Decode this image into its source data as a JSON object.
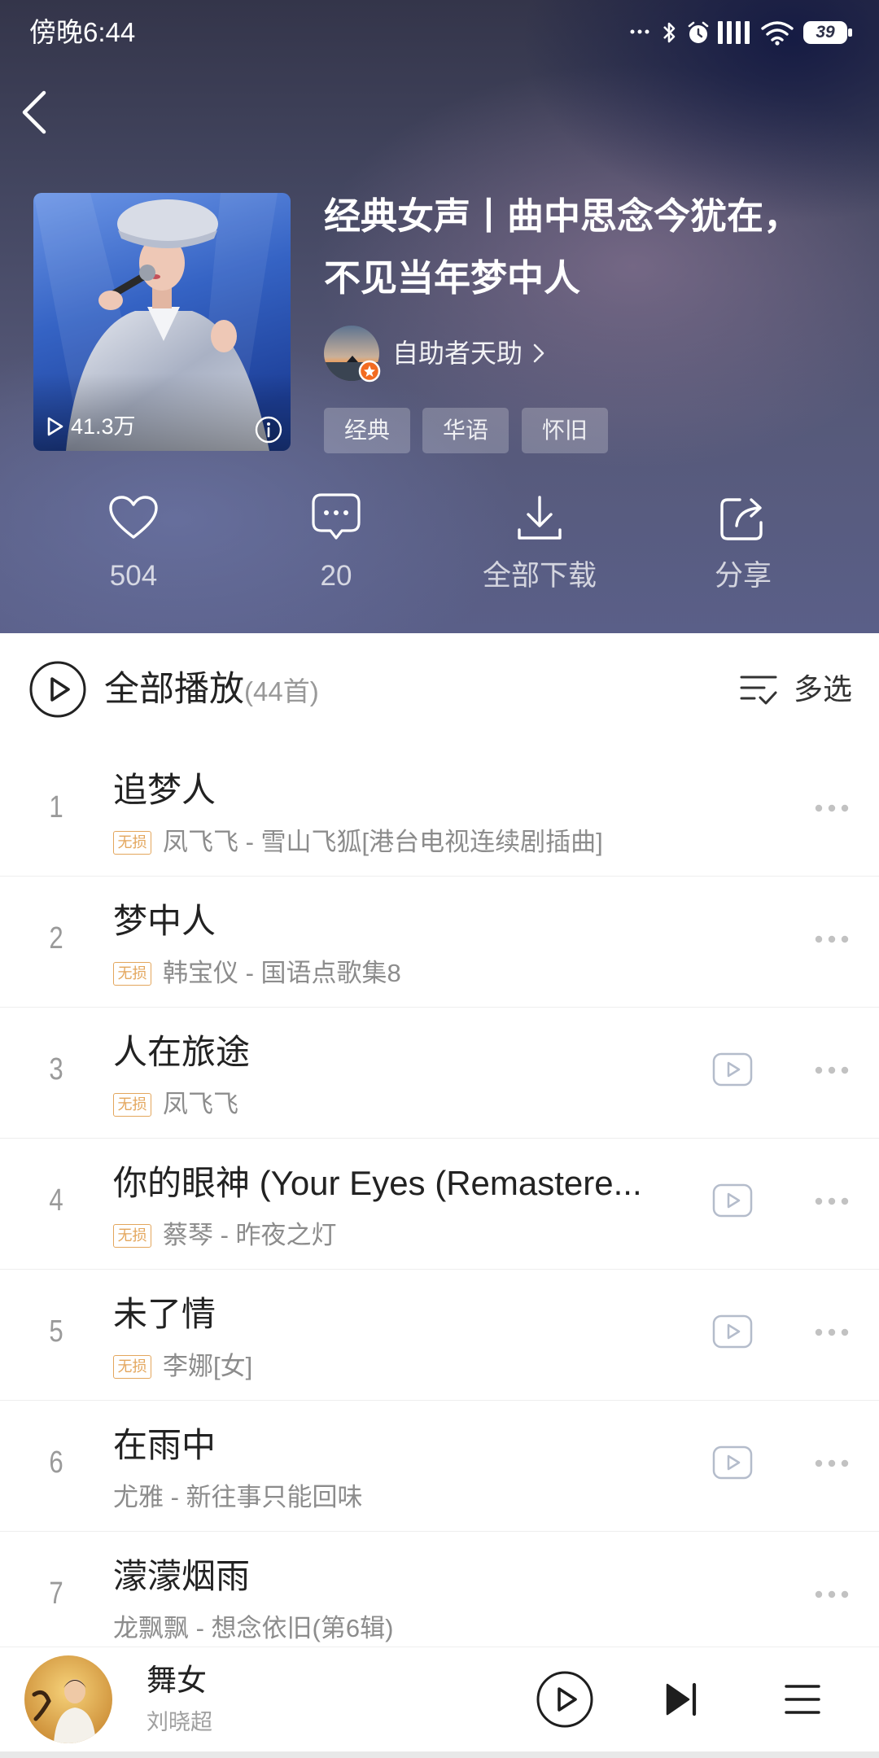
{
  "status_bar": {
    "time": "傍晚6:44",
    "battery": "39"
  },
  "playlist": {
    "title": "经典女声丨曲中思念今犹在，不见当年梦中人",
    "play_count": "41.3万",
    "creator": "自助者天助",
    "tags": [
      "经典",
      "华语",
      "怀旧"
    ]
  },
  "actions": {
    "like_count": "504",
    "comment_count": "20",
    "download_label": "全部下载",
    "share_label": "分享"
  },
  "play_all": {
    "label": "全部播放",
    "count": "(44首)",
    "multi_select": "多选"
  },
  "song_list": {
    "badge_label": "无损"
  },
  "songs": [
    {
      "index": "1",
      "title": "追梦人",
      "lossless": true,
      "subtitle": "凤飞飞 - 雪山飞狐[港台电视连续剧插曲]",
      "mv": false
    },
    {
      "index": "2",
      "title": "梦中人",
      "lossless": true,
      "subtitle": "韩宝仪 - 国语点歌集8",
      "mv": false
    },
    {
      "index": "3",
      "title": "人在旅途",
      "lossless": true,
      "subtitle": "凤飞飞",
      "mv": true
    },
    {
      "index": "4",
      "title": "你的眼神 (Your Eyes (Remastere...",
      "lossless": true,
      "subtitle": "蔡琴 - 昨夜之灯",
      "mv": true
    },
    {
      "index": "5",
      "title": "未了情",
      "lossless": true,
      "subtitle": "李娜[女]",
      "mv": true
    },
    {
      "index": "6",
      "title": "在雨中",
      "lossless": false,
      "subtitle": "尤雅 - 新往事只能回味",
      "mv": true
    },
    {
      "index": "7",
      "title": "濛濛烟雨",
      "lossless": false,
      "subtitle": "龙飘飘 - 想念依旧(第6辑)",
      "mv": false
    }
  ],
  "mini_player": {
    "title": "舞女",
    "artist": "刘晓超"
  },
  "colors": {
    "text_primary": "#222222",
    "text_secondary": "#999999",
    "badge": "#e3a65c",
    "divider": "#eeeeee",
    "icon_muted": "#b4bccb",
    "header_text": "#ffffff"
  }
}
